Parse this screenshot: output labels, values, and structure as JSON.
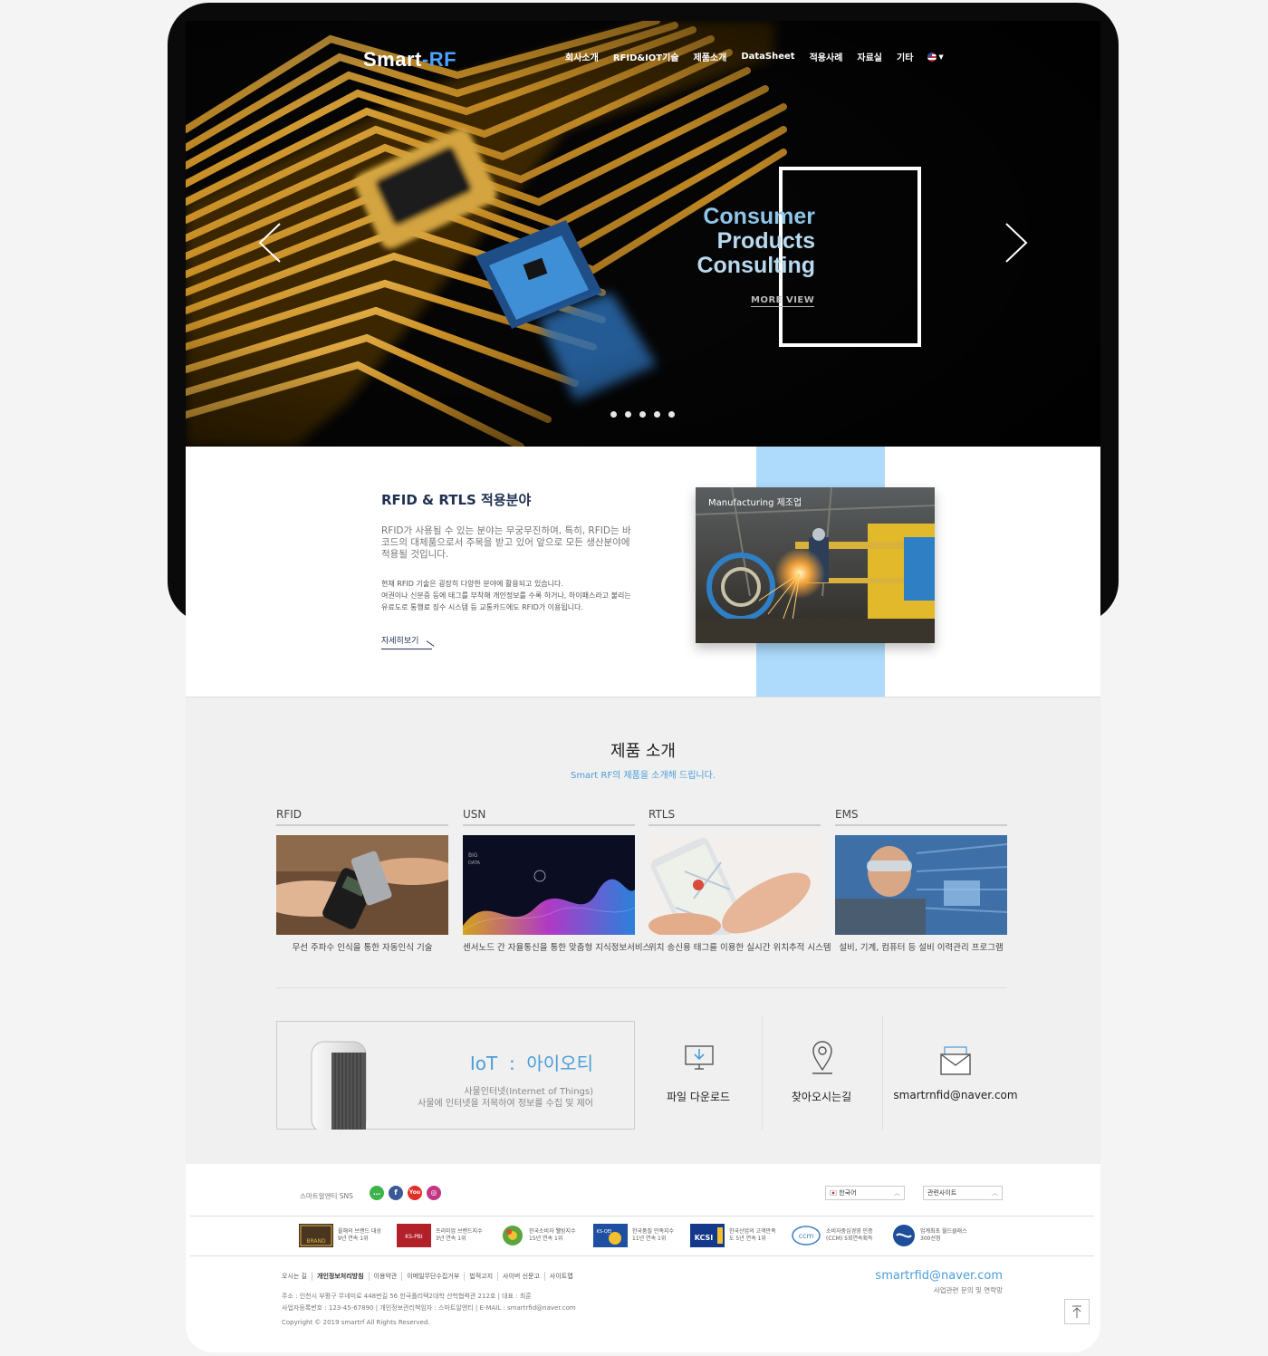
{
  "header": {
    "logo_main": "Smart",
    "logo_dash": "-",
    "logo_accent": "RF",
    "nav": [
      "회사소개",
      "RFID&IOT기술",
      "제품소개",
      "DataSheet",
      "적용사례",
      "자료실",
      "기타"
    ],
    "lang_icon": "us-flag-icon"
  },
  "hero": {
    "title_lines": [
      "Consumer",
      "Products",
      "Consulting"
    ],
    "more_label": "MORE VIEW",
    "slides": 5,
    "active_slide": 1
  },
  "rfid": {
    "title": "RFID & RTLS 적용분야",
    "desc1": "RFID가 사용될 수 있는 분야는 무궁무진하며, 특히, RFID는 바코드의 대체품으로서 주목을 받고 있어 앞으로 모든 생산분야에 적용될 것입니다.",
    "desc2_lines": [
      "현재 RFID 기술은 굉장히 다양한 분야에 활용되고 있습니다.",
      "여권이나 신분증 등에 태그를 부착해 개인정보를 수록 하거나, 하이패스라고 불리는",
      "유료도로 통행료 징수 시스템 등 교통카드에도 RFID가 이용됩니다."
    ],
    "more_label": "자세히보기",
    "image_caption": "Manufacturing 제조업"
  },
  "products": {
    "title": "제품 소개",
    "subtitle": "Smart RF의 제품을 소개해 드립니다.",
    "cards": [
      {
        "label": "RFID",
        "desc": "무선 주파수 인식을 통한 자동인식 기술"
      },
      {
        "label": "USN",
        "desc": "센서노드 간 자율통신을 통한 맞춤형 지식정보서비스"
      },
      {
        "label": "RTLS",
        "desc": "위치 송신용 태그를 이용한 실시간 위치추적 시스템"
      },
      {
        "label": "EMS",
        "desc": "설비, 기계, 컴퓨터 등 설비 이력관리 프로그램"
      }
    ],
    "usn_image_text": [
      "BIG",
      "DATA"
    ],
    "iot": {
      "head": "IoT  :  아이오티",
      "line1": "사물인터넷(Internet of Things)",
      "line2": "사물에 인터넷을 저목하여 정보를 수집 및 제어"
    },
    "quick_links": [
      {
        "label": "파일 다운로드",
        "icon": "download-monitor-icon"
      },
      {
        "label": "찾아오시는길",
        "icon": "location-pin-icon"
      },
      {
        "label": "smartrnfid@naver.com",
        "icon": "envelope-icon"
      }
    ]
  },
  "footer": {
    "sns_label": "스마트알앤티 SNS",
    "sns": [
      {
        "name": "talk",
        "color": "#3cb44b",
        "glyph": "…"
      },
      {
        "name": "facebook",
        "color": "#3b5998",
        "glyph": "f"
      },
      {
        "name": "youtube",
        "color": "#e52d27",
        "glyph": "You"
      },
      {
        "name": "instagram",
        "color": "#c13584",
        "glyph": "◎"
      }
    ],
    "lang_select": "한국어",
    "related_select": "관련사이트",
    "awards": [
      {
        "badge": "BRAND",
        "lines": [
          "올해의 브랜드 대상",
          "9년 연속 1위"
        ]
      },
      {
        "badge": "KS-PBI",
        "lines": [
          "프리미엄 브랜드지수",
          "3년 연속 1위"
        ]
      },
      {
        "badge": "",
        "lines": [
          "한국소비자 웰빙지수",
          "15년 연속 1위"
        ]
      },
      {
        "badge": "KS-QEI",
        "lines": [
          "한국품질 만족지수",
          "11년 연속 1위"
        ]
      },
      {
        "badge": "KCSI",
        "lines": [
          "한국산업의 고객만족",
          "도 5년 연속 1위"
        ]
      },
      {
        "badge": "ccm",
        "lines": [
          "소비자중심경영 인증",
          "(CCM) 5회연속획득"
        ]
      },
      {
        "badge": "",
        "lines": [
          "업계최초 월드클래스",
          "300선정"
        ]
      }
    ],
    "links": [
      "오시는 길",
      "개인정보처리방침",
      "이용약관",
      "이메일무단수집거부",
      "법적고지",
      "사이버 신문고",
      "사이트맵"
    ],
    "address": "주소 : 인천시 부평구 무네미로 448번길 56 한국폴리텍2대학 산학협력관 212호  |  대표 : 최훈",
    "business": "사업자등록번호 : 123-45-67890  |  개인정보관리책임자 : 스마트알앤티  |  E-MAIL : smartrfid@naver.com",
    "copyright": "Copyright © 2019  smartrf  All Rights Reserved.",
    "email": "smartrfid@naver.com",
    "email_sub": "사업관련 문의 및 연락망"
  },
  "colors": {
    "accent": "#4a9ed8",
    "navy": "#1f3051",
    "strip": "#aedbfb",
    "gold": "#d9a43a"
  }
}
